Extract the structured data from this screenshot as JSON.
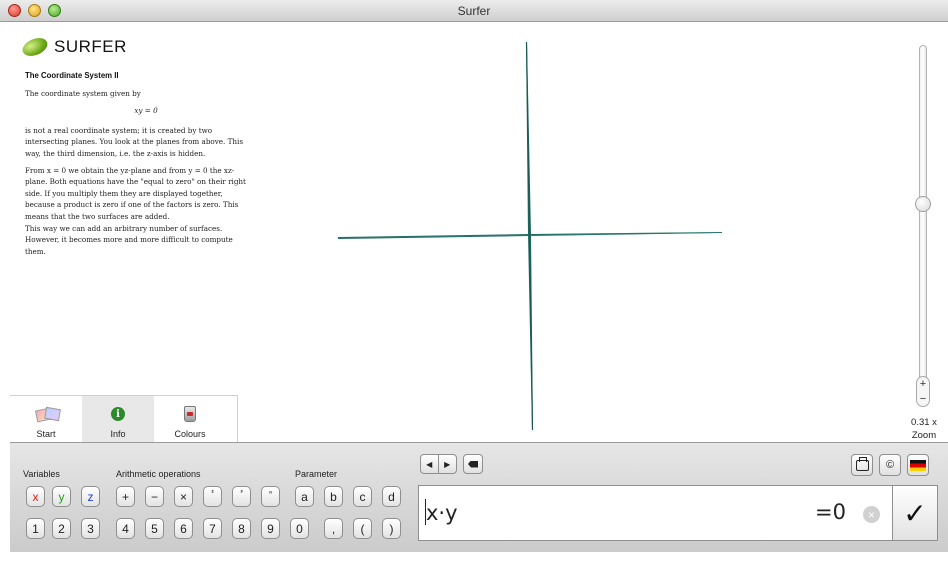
{
  "window": {
    "title": "Surfer"
  },
  "app": {
    "logo_text": "SURFER"
  },
  "info": {
    "heading": "The Coordinate System II",
    "intro": "The coordinate system given by",
    "equation": "xy = 0",
    "para1": "is not a real coordinate system; it is created by two intersecting planes. You look at the planes from above. This way, the third dimension, i.e. the z-axis is hidden.",
    "para2": "From x = 0 we obtain the yz-plane and from y = 0 the xz-plane. Both equations have the \"equal to zero\" on their right side. If you multiply them they are displayed together, because a product is zero if one of the factors is zero. This means that the two surfaces are added.",
    "para3": "This way we can add an arbitrary number of surfaces. However, it becomes more and more difficult to compute them."
  },
  "tabs": [
    {
      "label": "Start",
      "icon": "pictures-icon"
    },
    {
      "label": "Info",
      "icon": "info-icon"
    },
    {
      "label": "Colours",
      "icon": "paint-bucket-icon"
    }
  ],
  "zoom": {
    "value": "0.31 x",
    "label": "Zoom",
    "plus": "+",
    "minus": "−",
    "level": 0.55
  },
  "keyboard": {
    "variables_label": "Variables",
    "arithmetic_label": "Arithmetic operations",
    "parameter_label": "Parameter",
    "variables": [
      "x",
      "y",
      "z"
    ],
    "operations": [
      "+",
      "−",
      "×",
      "²",
      "³",
      "ⁿ"
    ],
    "parameters": [
      "a",
      "b",
      "c",
      "d"
    ],
    "digits": [
      "1",
      "2",
      "3",
      "4",
      "5",
      "6",
      "7",
      "8",
      "9",
      "0",
      ",",
      "(",
      ")"
    ]
  },
  "nav": {
    "prev": "◀",
    "next": "▶"
  },
  "formula": {
    "value": "x·y",
    "equals": "=0",
    "clear": "×",
    "confirm": "✓"
  },
  "toolbar": {
    "copyright": "©"
  },
  "colors": {
    "surface": "#1f6b62",
    "variable_x": "#e02020",
    "variable_y": "#2a9a2a",
    "variable_z": "#2040d8"
  }
}
